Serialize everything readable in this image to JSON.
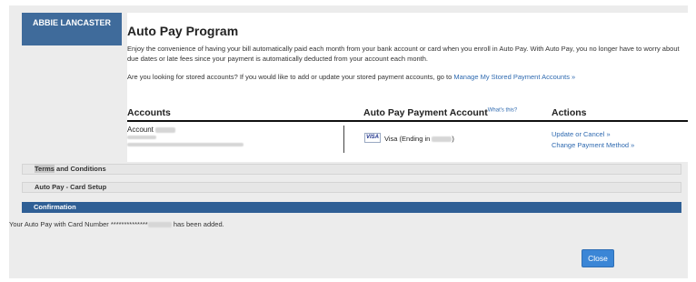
{
  "account_holder": "ABBIE LANCASTER",
  "program": {
    "title": "Auto Pay Program",
    "intro": "Enjoy the convenience of having your bill automatically paid each month from your bank account or card when you enroll in Auto Pay. With Auto Pay, you no longer have to worry about due dates or late fees since your payment is automatically deducted from your account each month.",
    "stored_question": "Are you looking for stored accounts? If you would like to add or update your stored payment accounts, go to",
    "stored_link": "Manage My Stored Payment Accounts »"
  },
  "table": {
    "headers": {
      "accounts": "Accounts",
      "payment_account": "Auto Pay Payment Account",
      "whats_this": "What's this?",
      "actions": "Actions"
    },
    "row": {
      "account_label": "Account",
      "card_brand": "VISA",
      "card_text_prefix": "Visa (Ending in",
      "card_text_suffix": ")",
      "actions": [
        "Update or Cancel »",
        "Change Payment Method »"
      ]
    }
  },
  "sections": {
    "terms_highlight": "Terms",
    "terms_rest": " and Conditions",
    "card_setup": "Auto Pay - Card Setup",
    "confirmation": "Confirmation"
  },
  "confirmation": {
    "message_prefix": "Your Auto Pay with Card Number **************",
    "message_suffix": "has been added.",
    "close_label": "Close"
  },
  "colors": {
    "brand_blue": "#3f6b9b",
    "link_blue": "#2f6ab0",
    "button_blue": "#3b86d6"
  }
}
